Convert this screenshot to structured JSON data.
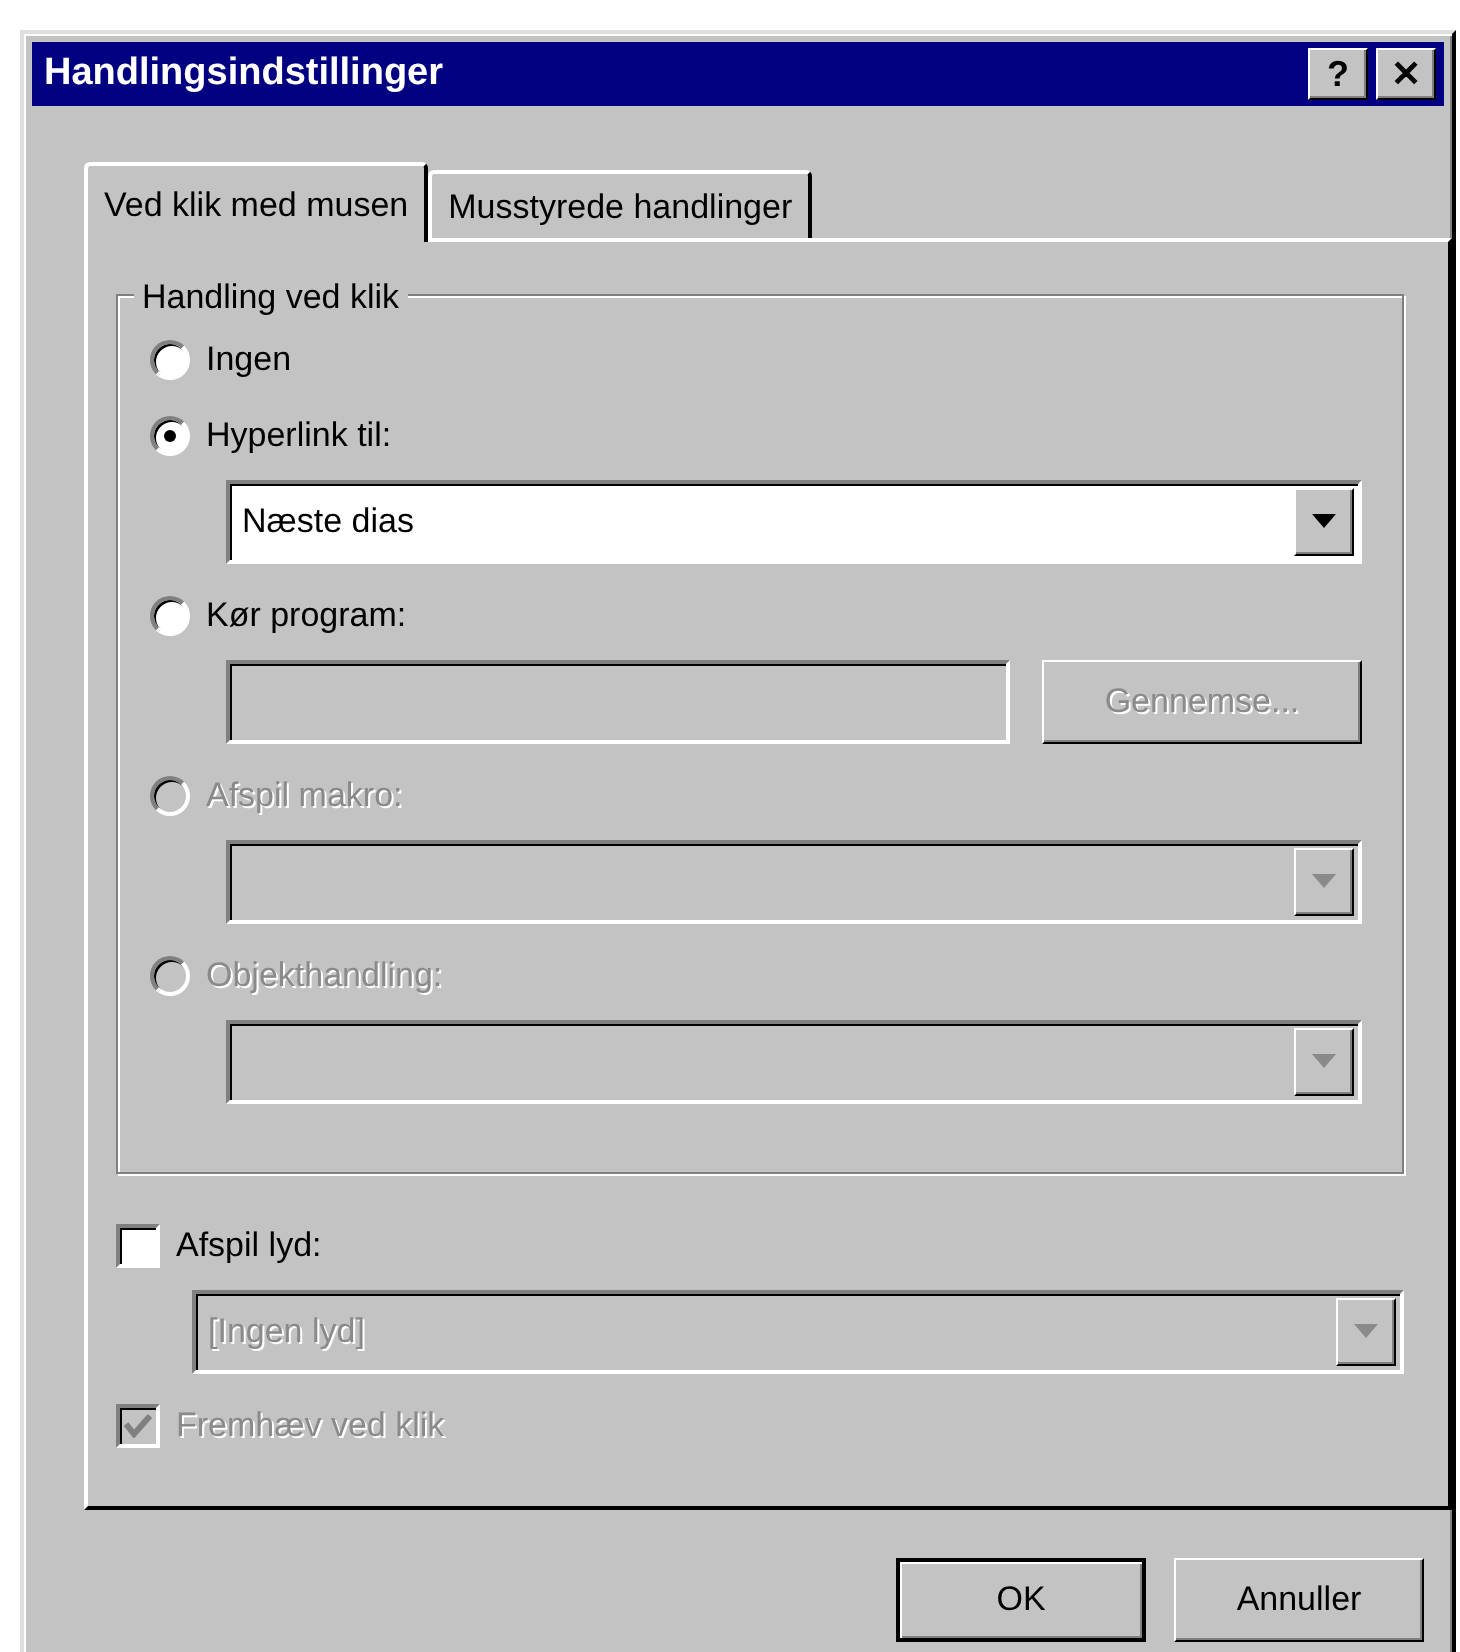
{
  "window": {
    "title": "Handlingsindstillinger",
    "title_buttons": [
      "?",
      "✕"
    ]
  },
  "tabs": [
    {
      "label": "Ved klik med musen",
      "selected": true
    },
    {
      "label": "Musstyrede handlinger",
      "selected": false
    }
  ],
  "group": {
    "title": "Handling ved klik",
    "options": [
      {
        "label": "Ingen",
        "selected": false,
        "disabled": false
      },
      {
        "label": "Hyperlink til:",
        "selected": true,
        "disabled": false,
        "control": {
          "kind": "combo",
          "value": "Næste dias",
          "disabled": false
        }
      },
      {
        "label": "Kør program:",
        "selected": false,
        "disabled": false,
        "control": {
          "kind": "field",
          "disabled": true,
          "button": "Gennemse..."
        }
      },
      {
        "label": "Afspil makro:",
        "selected": false,
        "disabled": true,
        "control": {
          "kind": "combo",
          "disabled": true
        }
      },
      {
        "label": "Objekthandling:",
        "selected": false,
        "disabled": true,
        "control": {
          "kind": "combo",
          "disabled": true
        }
      }
    ]
  },
  "sound": {
    "label": "Afspil lyd:",
    "checked": false,
    "disabled": false,
    "combo": {
      "value": "[Ingen lyd]",
      "disabled": true
    }
  },
  "highlight": {
    "label": "Fremhæv ved klik",
    "checked": true,
    "disabled": true
  },
  "buttons": [
    "OK",
    "Annuller"
  ]
}
